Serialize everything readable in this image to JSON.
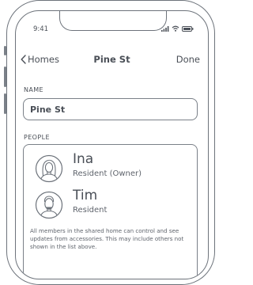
{
  "status_bar": {
    "time": "9:41",
    "icons": [
      "cellular-signal-icon",
      "wifi-icon",
      "battery-icon"
    ]
  },
  "nav": {
    "back_label": "Homes",
    "title": "Pine St",
    "done_label": "Done"
  },
  "name_section": {
    "label": "NAME",
    "value": "Pine St"
  },
  "people_section": {
    "label": "PEOPLE",
    "members": [
      {
        "name": "Ina",
        "role": "Resident (Owner)",
        "avatar": "woman-avatar-icon"
      },
      {
        "name": "Tim",
        "role": "Resident",
        "avatar": "man-avatar-icon"
      }
    ],
    "footnote": "All members in the shared home can control and see updates from accessories. This may include others not shown in the list above."
  },
  "colors": {
    "line": "#6d737b",
    "text": "#4a4f57"
  }
}
